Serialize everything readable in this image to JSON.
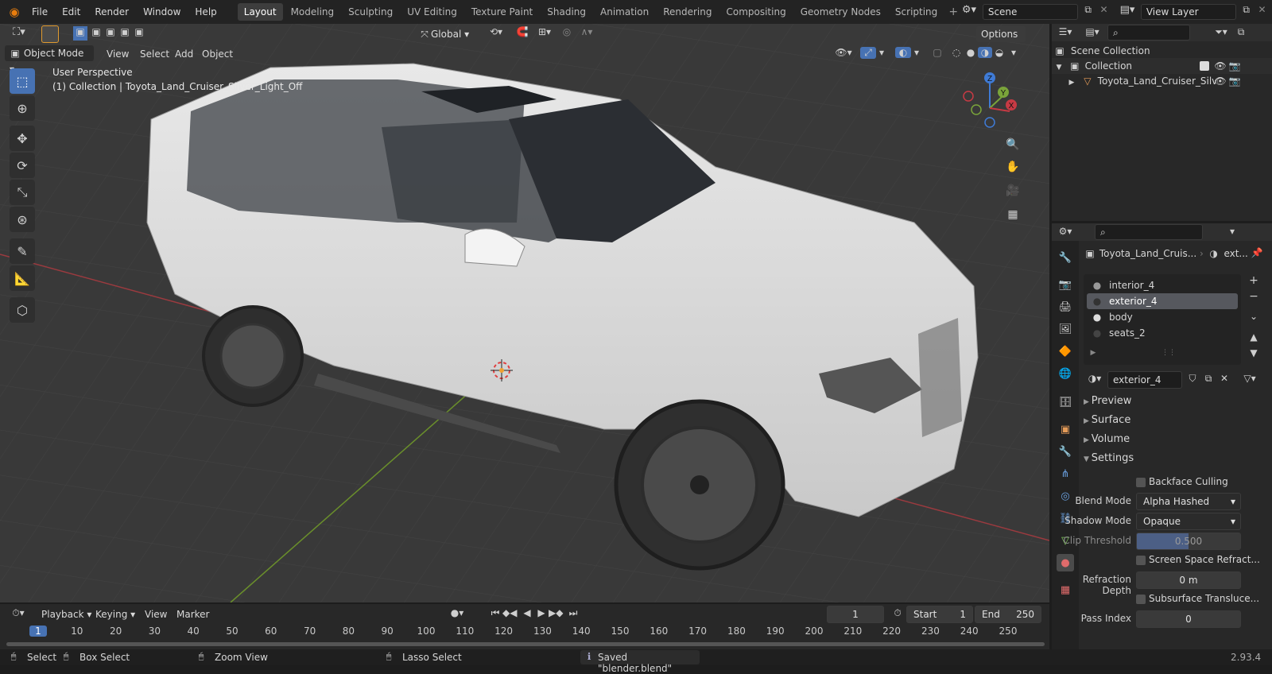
{
  "menu": {
    "file": "File",
    "edit": "Edit",
    "render": "Render",
    "window": "Window",
    "help": "Help"
  },
  "workspaces": [
    "Layout",
    "Modeling",
    "Sculpting",
    "UV Editing",
    "Texture Paint",
    "Shading",
    "Animation",
    "Rendering",
    "Compositing",
    "Geometry Nodes",
    "Scripting"
  ],
  "active_workspace": "Layout",
  "scene": {
    "name": "Scene",
    "view_layer": "View Layer"
  },
  "viewport_header": {
    "mode": "Object Mode",
    "view": "View",
    "select": "Select",
    "add": "Add",
    "object": "Object",
    "orientation": "Global",
    "options": "Options"
  },
  "viewport_overlay": {
    "perspective": "User Perspective",
    "collection_line": "(1) Collection | Toyota_Land_Cruiser_Silver_Light_Off"
  },
  "gizmo": {
    "z": "Z",
    "y": "Y",
    "x": "X"
  },
  "outliner": {
    "scene_collection": "Scene Collection",
    "collection": "Collection",
    "object": "Toyota_Land_Cruiser_Silv"
  },
  "properties": {
    "object_name": "Toyota_Land_Cruis...",
    "material_short": "ext...",
    "slots": [
      "interior_4",
      "exterior_4",
      "body",
      "seats_2"
    ],
    "active_slot": "exterior_4",
    "material_name": "exterior_4",
    "panels": {
      "preview": "Preview",
      "surface": "Surface",
      "volume": "Volume",
      "settings": "Settings"
    },
    "settings": {
      "backface_culling": "Backface Culling",
      "blend_mode_label": "Blend Mode",
      "blend_mode": "Alpha Hashed",
      "shadow_mode_label": "Shadow Mode",
      "shadow_mode": "Opaque",
      "clip_threshold_label": "Clip Threshold",
      "clip_threshold": "0.500",
      "screen_space_refraction": "Screen Space Refract...",
      "refraction_depth_label": "Refraction Depth",
      "refraction_depth": "0 m",
      "subsurface_translucency": "Subsurface Transluce...",
      "pass_index_label": "Pass Index",
      "pass_index": "0"
    }
  },
  "timeline": {
    "playback": "Playback",
    "keying": "Keying",
    "view": "View",
    "marker": "Marker",
    "current_frame": "1",
    "start_label": "Start",
    "start": "1",
    "end_label": "End",
    "end": "250",
    "ticks": [
      "1",
      "10",
      "20",
      "30",
      "40",
      "50",
      "60",
      "70",
      "80",
      "90",
      "100",
      "110",
      "120",
      "130",
      "140",
      "150",
      "160",
      "170",
      "180",
      "190",
      "200",
      "210",
      "220",
      "230",
      "240",
      "250"
    ]
  },
  "status": {
    "select": "Select",
    "box_select": "Box Select",
    "zoom_view": "Zoom View",
    "lasso_select": "Lasso Select",
    "message": "Saved \"blender.blend\"",
    "version": "2.93.4"
  },
  "colors": {
    "accent": "#4772b3",
    "x_axis": "#c63a44",
    "y_axis": "#7aa43a",
    "z_axis": "#3f7bd6"
  }
}
